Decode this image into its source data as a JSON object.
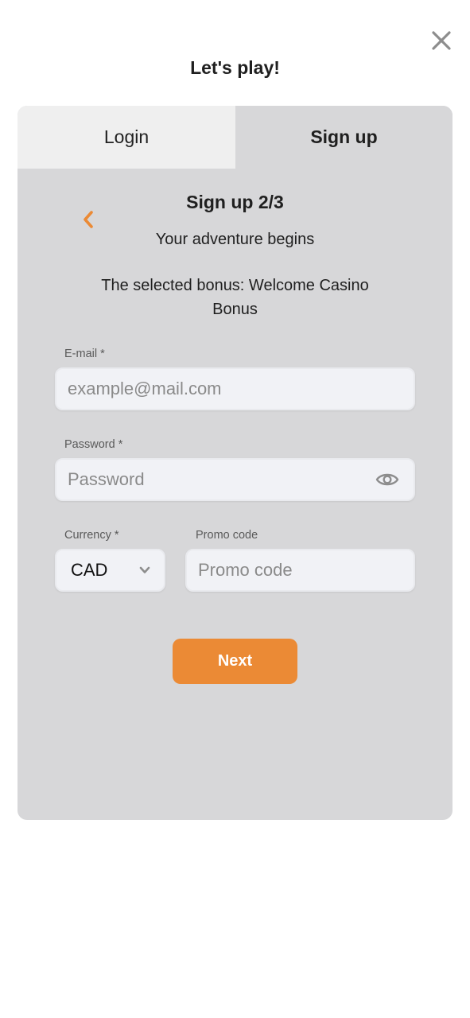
{
  "header": {
    "title": "Let's play!",
    "close_icon": "close-icon"
  },
  "tabs": [
    {
      "label": "Login",
      "active": false
    },
    {
      "label": "Sign up",
      "active": true
    }
  ],
  "step": {
    "title": "Sign up 2/3",
    "subtitle": "Your adventure begins",
    "bonus_text": "The selected bonus: Welcome Casino Bonus",
    "back_icon": "chevron-left-icon"
  },
  "form": {
    "email": {
      "label": "E-mail *",
      "placeholder": "example@mail.com",
      "value": ""
    },
    "password": {
      "label": "Password *",
      "placeholder": "Password",
      "value": "",
      "toggle_icon": "eye-icon"
    },
    "currency": {
      "label": "Currency *",
      "value": "CAD",
      "chevron_icon": "chevron-down-icon"
    },
    "promo": {
      "label": "Promo code",
      "placeholder": "Promo code",
      "value": ""
    }
  },
  "actions": {
    "next_label": "Next"
  },
  "colors": {
    "accent": "#eb8a35",
    "card_bg": "#d7d7d9",
    "inactive_tab_bg": "#efefef",
    "input_bg": "#f1f2f6"
  }
}
